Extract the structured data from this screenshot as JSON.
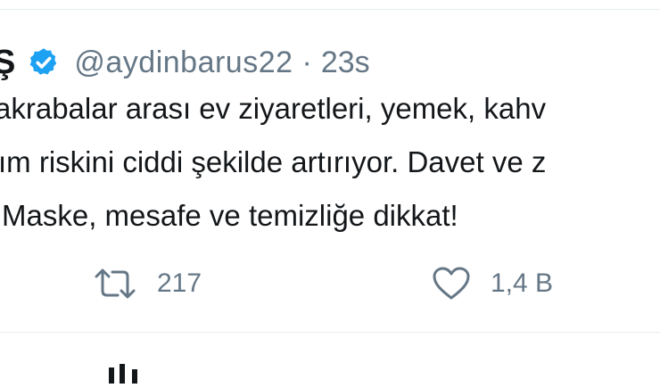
{
  "tweet": {
    "author_name": "Ş",
    "handle": "@aydinbarus22",
    "separator": "·",
    "time": "23s",
    "text_lines": [
      "akrabalar arası ev ziyaretleri, yemek, kahv",
      "ım riskini ciddi şekilde artırıyor. Davet ve z",
      "Maske, mesafe ve temizliğe dikkat!"
    ],
    "retweet_count": "217",
    "like_count": "1,4 B"
  },
  "icons": {
    "verified": "verified-badge-icon",
    "retweet": "retweet-icon",
    "like": "heart-icon"
  },
  "colors": {
    "verified_blue": "#1da1f2",
    "secondary_text": "#657786",
    "primary_text": "#14171a",
    "border": "#e6ecf0"
  }
}
